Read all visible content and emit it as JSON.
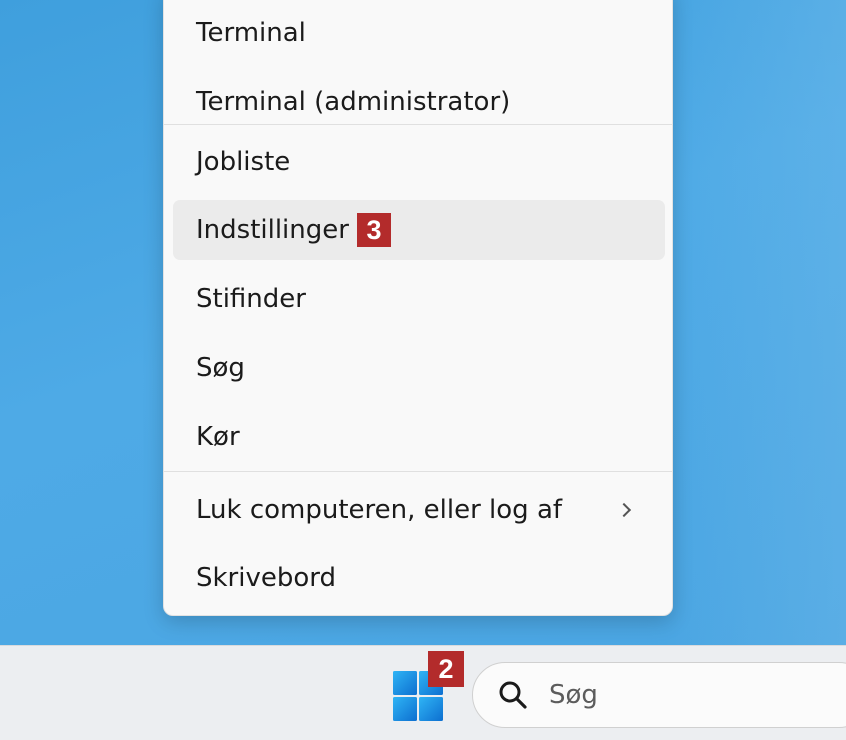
{
  "context_menu": {
    "items": [
      {
        "label": "Terminal"
      },
      {
        "label": "Terminal (administrator)"
      },
      {
        "label": "Jobliste"
      },
      {
        "label": "Indstillinger",
        "badge": "3"
      },
      {
        "label": "Stifinder"
      },
      {
        "label": "Søg"
      },
      {
        "label": "Kør"
      },
      {
        "label": "Luk computeren, eller log af",
        "has_submenu": true
      },
      {
        "label": "Skrivebord"
      }
    ]
  },
  "taskbar": {
    "start_badge": "2",
    "search_placeholder": "Søg"
  },
  "colors": {
    "desktop": "#4aa8e3",
    "badge": "#b32b2b",
    "menu_bg": "#f9f9f9",
    "highlight": "#ebebeb"
  }
}
